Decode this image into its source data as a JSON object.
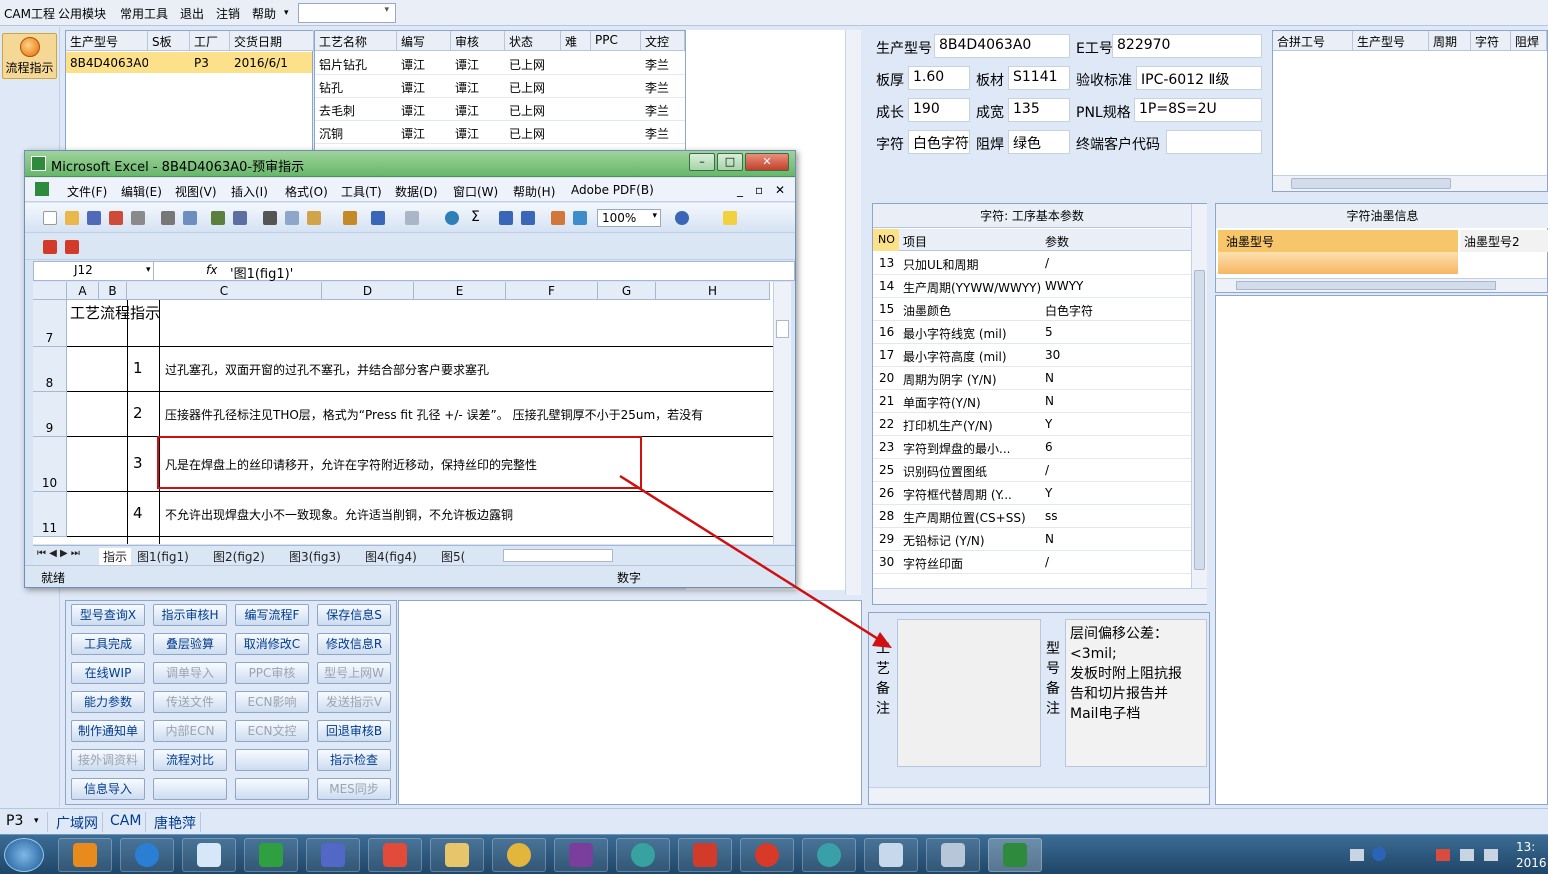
{
  "menu": {
    "items": [
      "CAM工程",
      "公用模块",
      "常用工具",
      "退出",
      "注销",
      "帮助"
    ],
    "dropdown_arrow": "▾"
  },
  "nav": {
    "flow_label": "流程指示"
  },
  "orders": {
    "headers": [
      "生产型号",
      "S板",
      "工厂",
      "交货日期"
    ],
    "rows": [
      [
        "8B4D4063A0",
        "",
        "P3",
        "2016/6/1"
      ]
    ]
  },
  "processes": {
    "headers": [
      "工艺名称",
      "编写",
      "审核",
      "状态",
      "难",
      "PPC",
      "文控"
    ],
    "rows": [
      [
        "铝片钻孔",
        "谭江",
        "谭江",
        "已上网",
        "",
        "",
        "李兰"
      ],
      [
        "钻孔",
        "谭江",
        "谭江",
        "已上网",
        "",
        "",
        "李兰"
      ],
      [
        "去毛刺",
        "谭江",
        "谭江",
        "已上网",
        "",
        "",
        "李兰"
      ],
      [
        "沉铜",
        "谭江",
        "谭江",
        "已上网",
        "",
        "",
        "李兰"
      ]
    ]
  },
  "buttons": [
    [
      "型号查询X",
      "指示审核H",
      "编写流程F",
      "保存信息S"
    ],
    [
      "工具完成",
      "叠层验算",
      "取消修改C",
      "修改信息R"
    ],
    [
      "在线WIP",
      "调单导入",
      "PPC审核",
      "型号上网W"
    ],
    [
      "能力参数",
      "传送文件",
      "ECN影响",
      "发送指示V"
    ],
    [
      "制作通知单",
      "内部ECN",
      "ECN文控",
      "回退审核B"
    ],
    [
      "接外调资料",
      "流程对比",
      "",
      "指示检查"
    ],
    [
      "信息导入",
      "",
      "",
      "MES同步"
    ]
  ],
  "buttons_disabled": [
    [
      false,
      false,
      false,
      false
    ],
    [
      false,
      false,
      false,
      false
    ],
    [
      false,
      true,
      true,
      true
    ],
    [
      false,
      true,
      true,
      true
    ],
    [
      false,
      true,
      true,
      false
    ],
    [
      true,
      false,
      false,
      false
    ],
    [
      false,
      false,
      false,
      true
    ]
  ],
  "info": {
    "model_label": "生产型号",
    "model": "8B4D4063A0",
    "ework_label": "E工号",
    "ework": "822970",
    "thick_label": "板厚",
    "thick": "1.60",
    "mat_label": "板材",
    "mat": "S1141",
    "std_label": "验收标准",
    "std": "IPC-6012 Ⅱ级",
    "len_label": "成长",
    "len": "190",
    "wid_label": "成宽",
    "wid": "135",
    "pnl_label": "PNL规格",
    "pnl": "1P=8S=2U",
    "char_label": "字符",
    "char": "白色字符",
    "mask_label": "阻焊",
    "mask": "绿色",
    "cust_label": "终端客户代码",
    "cust": ""
  },
  "right_table": {
    "headers": [
      "合拼工号",
      "生产型号",
      "周期",
      "字符",
      "阻焊"
    ]
  },
  "params": {
    "title": "字符: 工序基本参数",
    "headers": [
      "NO",
      "项目",
      "参数"
    ],
    "rows": [
      [
        "13",
        "只加UL和周期",
        "/"
      ],
      [
        "14",
        "生产周期(YYWW/WWYY)",
        "WWYY"
      ],
      [
        "15",
        "油墨颜色",
        "白色字符"
      ],
      [
        "16",
        "最小字符线宽 (mil)",
        "5"
      ],
      [
        "17",
        "最小字符高度 (mil)",
        "30"
      ],
      [
        "20",
        "周期为阴字 (Y/N)",
        "N"
      ],
      [
        "21",
        "单面字符(Y/N)",
        "N"
      ],
      [
        "22",
        "打印机生产(Y/N)",
        "Y"
      ],
      [
        "23",
        "字符到焊盘的最小...",
        "6"
      ],
      [
        "25",
        "识别码位置图纸",
        "/"
      ],
      [
        "26",
        "字符框代替周期 (Y...",
        "Y"
      ],
      [
        "28",
        "生产周期位置(CS+SS)",
        "ss"
      ],
      [
        "29",
        "无铅标记 (Y/N)",
        "N"
      ],
      [
        "30",
        "字符丝印面",
        "/"
      ]
    ]
  },
  "ink": {
    "title": "字符油墨信息",
    "headers": [
      "油墨型号",
      "油墨型号2"
    ]
  },
  "notes": {
    "process_label": [
      "工",
      "艺",
      "备",
      "注"
    ],
    "model_label": [
      "型",
      "号",
      "备",
      "注"
    ],
    "model_text": [
      "层间偏移公差：",
      "<3mil;",
      "发板时附上阻抗报",
      "告和切片报告并",
      "Mail电子档"
    ]
  },
  "bottom": {
    "items": [
      "P3",
      "广域网",
      "CAM",
      "唐艳萍"
    ]
  },
  "excel": {
    "title": "Microsoft Excel - 8B4D4063A0-预审指示",
    "menu": [
      "文件(F)",
      "编辑(E)",
      "视图(V)",
      "插入(I)",
      "格式(O)",
      "工具(T)",
      "数据(D)",
      "窗口(W)",
      "帮助(H)",
      "Adobe PDF(B)"
    ],
    "zoom": "100%",
    "cell_ref": "J12",
    "fx": "fx",
    "formula": "'图1(fig1)'",
    "cols": [
      "A",
      "B",
      "C",
      "D",
      "E",
      "F",
      "G",
      "H"
    ],
    "rows": [
      {
        "num": "7",
        "a": "工艺流程指示",
        "b": "",
        "c": ""
      },
      {
        "num": "8",
        "a": "",
        "b": "1",
        "c": "过孔塞孔，双面开窗的过孔不塞孔，并结合部分客户要求塞孔"
      },
      {
        "num": "9",
        "a": "",
        "b": "2",
        "c": "压接器件孔径标注见THO层，格式为“Press fit 孔径 +/- 误差”。  压接孔壁铜厚不小于25um，若没有"
      },
      {
        "num": "10",
        "a": "",
        "b": "3",
        "c": "凡是在焊盘上的丝印请移开，允许在字符附近移动，保持丝印的完整性"
      },
      {
        "num": "11",
        "a": "",
        "b": "4",
        "c": "不允许出现焊盘大小不一致现象。允许适当削铜，不允许板边露铜"
      }
    ],
    "tabs": [
      "指示",
      "图1(fig1)",
      "图2(fig2)",
      "图3(fig3)",
      "图4(fig4)",
      "图5("
    ],
    "status_left": "就绪",
    "status_mid": "数字"
  },
  "clock": {
    "time": "13:",
    "year": "2016"
  },
  "colors": {
    "accent": "#d01010",
    "excel_green": "#66b76a",
    "selection": "#fce08a"
  }
}
